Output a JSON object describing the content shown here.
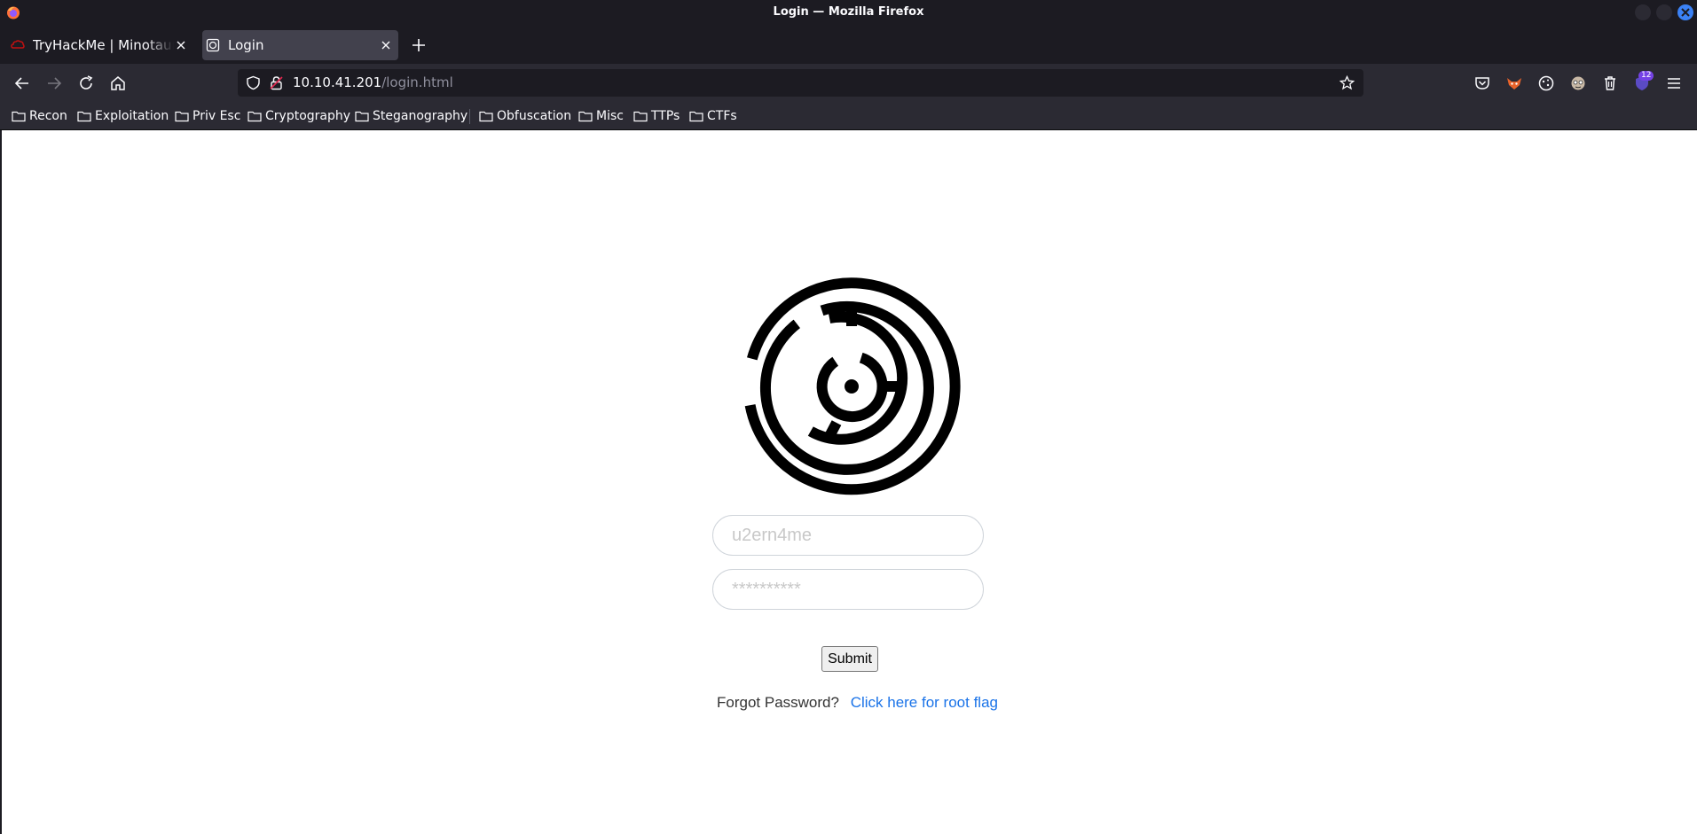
{
  "window": {
    "title": "Login — Mozilla Firefox"
  },
  "tabs": [
    {
      "label": "TryHackMe | Minotaur's Labyrinth",
      "icon": "tryhackme-icon",
      "active": false
    },
    {
      "label": "Login",
      "icon": "page-icon",
      "active": true
    }
  ],
  "urlbar": {
    "host": "10.10.41.201",
    "path": "/login.html"
  },
  "toolbar": {
    "extensions_badge": "12"
  },
  "bookmarks": [
    "Recon",
    "Exploitation",
    "Priv Esc",
    "Cryptography",
    "Steganography",
    "Obfuscation",
    "Misc",
    "TTPs",
    "CTFs"
  ],
  "login": {
    "username_placeholder": "u2ern4me",
    "password_placeholder": "**********",
    "submit_label": "Submit",
    "forgot_text": "Forgot Password?",
    "root_flag_link": "Click here for root flag"
  },
  "colors": {
    "accent": "#3b82f6",
    "link": "#1a73e8",
    "chrome_dark": "#1c1b22",
    "chrome": "#2b2a33"
  }
}
